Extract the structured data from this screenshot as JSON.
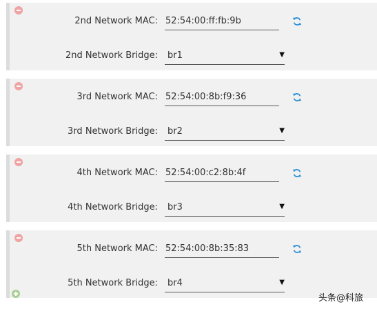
{
  "panels": [
    {
      "mac_label": "2nd Network MAC:",
      "mac_value": "52:54:00:ff:fb:9b",
      "bridge_label": "2nd Network Bridge:",
      "bridge_value": "br1"
    },
    {
      "mac_label": "3rd Network MAC:",
      "mac_value": "52:54:00:8b:f9:36",
      "bridge_label": "3rd Network Bridge:",
      "bridge_value": "br2"
    },
    {
      "mac_label": "4th Network MAC:",
      "mac_value": "52:54:00:c2:8b:4f",
      "bridge_label": "4th Network Bridge:",
      "bridge_value": "br3"
    },
    {
      "mac_label": "5th Network MAC:",
      "mac_value": "52:54:00:8b:35:83",
      "bridge_label": "5th Network Bridge:",
      "bridge_value": "br4"
    }
  ],
  "icons": {
    "remove": "minus-circle-icon",
    "add": "plus-circle-icon",
    "refresh": "refresh-icon",
    "dropdown": "caret-down-icon"
  },
  "colors": {
    "remove": "#f0a3a3",
    "add": "#a9cf95",
    "refresh": "#2a8fd6",
    "panel_bg": "#f1f1f1"
  },
  "watermark": "头条@科旅"
}
